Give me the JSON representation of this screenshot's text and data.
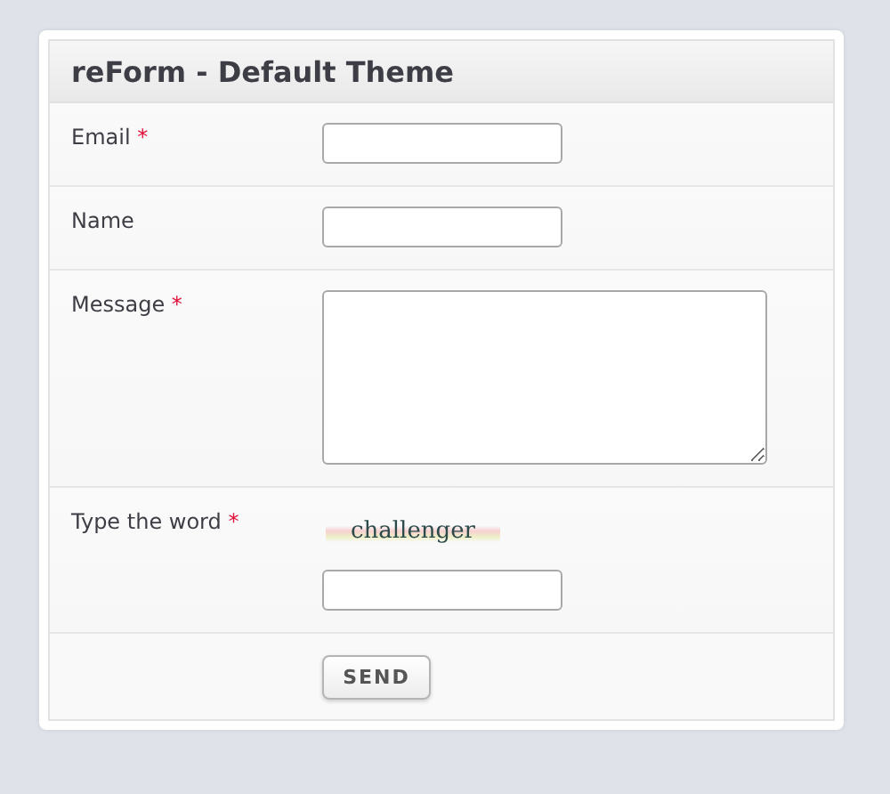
{
  "form": {
    "title": "reForm - Default Theme",
    "fields": [
      {
        "kind": "input",
        "label": "Email",
        "required_mark": "*"
      },
      {
        "kind": "input",
        "label": "Name"
      },
      {
        "kind": "textarea",
        "label": "Message",
        "required_mark": "*"
      },
      {
        "kind": "captcha",
        "label": "Type the word",
        "required_mark": "*",
        "word": "challenger"
      }
    ],
    "submit": "SEND"
  }
}
